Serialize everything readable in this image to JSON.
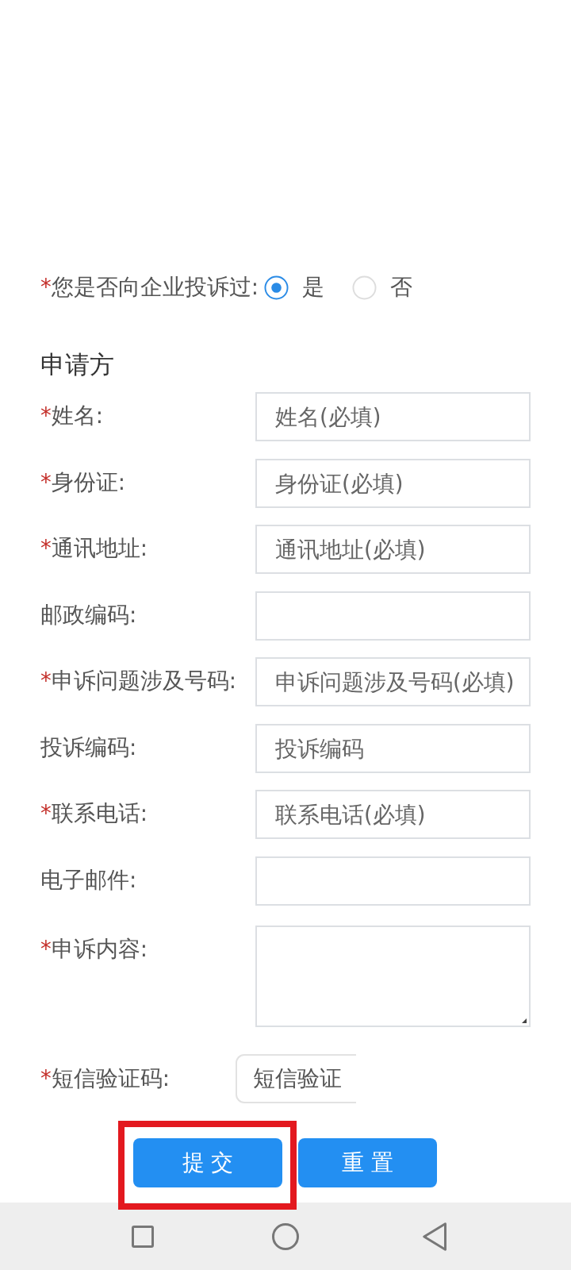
{
  "complaint_question": {
    "mark": "*",
    "label": "您是否向企业投诉过:",
    "options": [
      {
        "label": "是",
        "selected": true
      },
      {
        "label": "否",
        "selected": false
      }
    ]
  },
  "section_title": "申请方",
  "fields": [
    {
      "mark": "*",
      "label": "姓名:",
      "kind": "input",
      "placeholder": "姓名(必填)"
    },
    {
      "mark": "*",
      "label": "身份证:",
      "kind": "input",
      "placeholder": "身份证(必填)"
    },
    {
      "mark": "*",
      "label": "通讯地址:",
      "kind": "input",
      "placeholder": "通讯地址(必填)"
    },
    {
      "label": "邮政编码:",
      "kind": "input"
    },
    {
      "mark": "*",
      "label": "申诉问题涉及号码:",
      "kind": "input",
      "placeholder": "申诉问题涉及号码(必填)"
    },
    {
      "label": "投诉编码:",
      "kind": "input",
      "placeholder": "投诉编码"
    },
    {
      "mark": "*",
      "label": "联系电话:",
      "kind": "input",
      "placeholder": "联系电话(必填)"
    },
    {
      "label": "电子邮件:",
      "kind": "input"
    },
    {
      "mark": "*",
      "label": "申诉内容:",
      "kind": "textarea"
    }
  ],
  "sms": {
    "mark": "*",
    "label": "短信验证码:",
    "button": "短信验证"
  },
  "buttons": [
    {
      "label": "提 交",
      "highlighted": true
    },
    {
      "label": "重 置",
      "highlighted": false
    }
  ]
}
